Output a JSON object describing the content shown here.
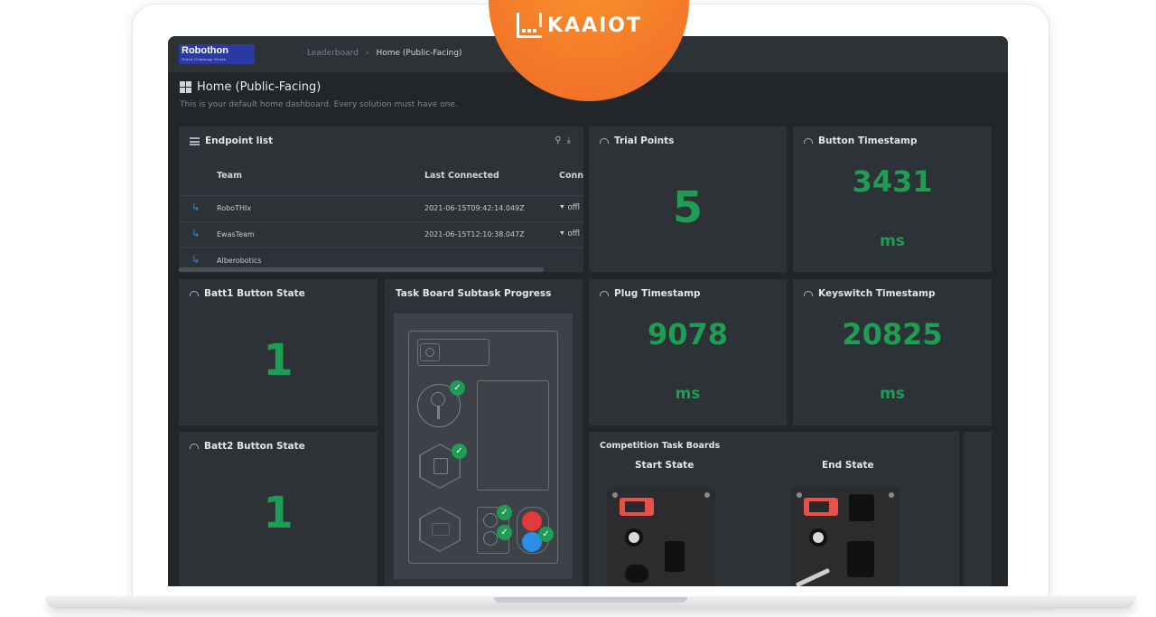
{
  "brand": {
    "name": "Robothon",
    "tagline": "Grand Challenge Series",
    "badge_logo_text": "KAAIOT"
  },
  "breadcrumb": {
    "items": [
      "Leaderboard",
      "Home (Public-Facing)"
    ]
  },
  "page": {
    "title": "Home (Public-Facing)",
    "subtitle": "This is your default home dashboard. Every solution must have one."
  },
  "endpoint_list": {
    "title": "Endpoint list",
    "columns": [
      "Team",
      "Last Connected",
      "Conn"
    ],
    "rows": [
      {
        "team": "RoboTHIx",
        "last_connected": "2021-06-15T09:42:14.049Z",
        "connection": "offl"
      },
      {
        "team": "EwasTeam",
        "last_connected": "2021-06-15T12:10:38.047Z",
        "connection": "offl"
      },
      {
        "team": "Alberobotics",
        "last_connected": "",
        "connection": ""
      }
    ]
  },
  "widgets": {
    "trial_points": {
      "title": "Trial Points",
      "value": "5"
    },
    "button_timestamp": {
      "title": "Button Timestamp",
      "value": "3431",
      "unit": "ms"
    },
    "plug_timestamp": {
      "title": "Plug Timestamp",
      "value": "9078",
      "unit": "ms"
    },
    "keyswitch_timestamp": {
      "title": "Keyswitch Timestamp",
      "value": "20825",
      "unit": "ms"
    },
    "batt1": {
      "title": "Batt1 Button State",
      "value": "1"
    },
    "batt2": {
      "title": "Batt2 Button State",
      "value": "1"
    },
    "task_board": {
      "title": "Task Board Subtask Progress"
    },
    "competition": {
      "title": "Competition Task Boards",
      "start_label": "Start State",
      "end_label": "End State"
    }
  },
  "colors": {
    "accent_green": "#1f9d55",
    "link_blue": "#3d8bd9",
    "badge_orange": "#f47a2a",
    "panel_bg": "#2d3236"
  }
}
